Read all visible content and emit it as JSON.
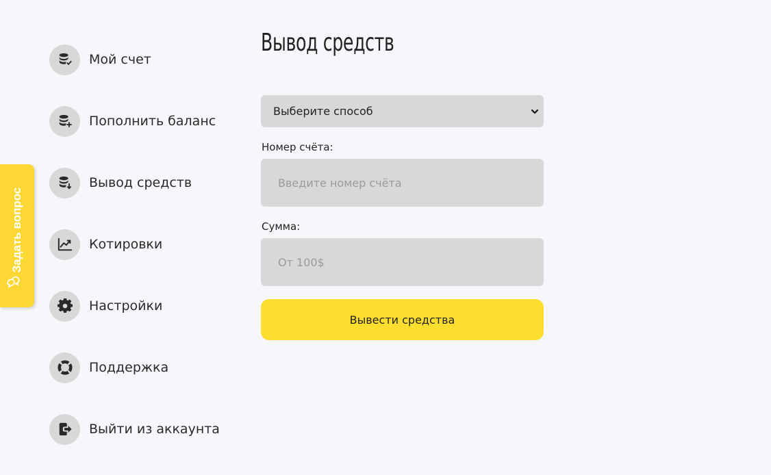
{
  "side_tab": {
    "label": "Задать вопрос",
    "icon": "chat-bubbles-icon"
  },
  "sidebar": {
    "items": [
      {
        "label": "Мой счет",
        "icon": "coins-check-icon"
      },
      {
        "label": "Пополнить баланс",
        "icon": "coins-plus-icon"
      },
      {
        "label": "Вывод средств",
        "icon": "coins-download-icon"
      },
      {
        "label": "Котировки",
        "icon": "chart-line-icon"
      },
      {
        "label": "Настройки",
        "icon": "gear-icon"
      },
      {
        "label": "Поддержка",
        "icon": "lifebuoy-icon"
      },
      {
        "label": "Выйти из аккаунта",
        "icon": "logout-icon"
      }
    ]
  },
  "main": {
    "title": "Вывод средств",
    "method_select": {
      "value": "Выберите способ"
    },
    "account": {
      "label": "Номер счёта:",
      "placeholder": "Введите номер счёта"
    },
    "amount": {
      "label": "Сумма:",
      "placeholder": "От 100$"
    },
    "submit_label": "Вывести средства"
  },
  "colors": {
    "accent": "#fdde2f",
    "background": "#f6f7fa",
    "field": "#d8d8d8"
  }
}
